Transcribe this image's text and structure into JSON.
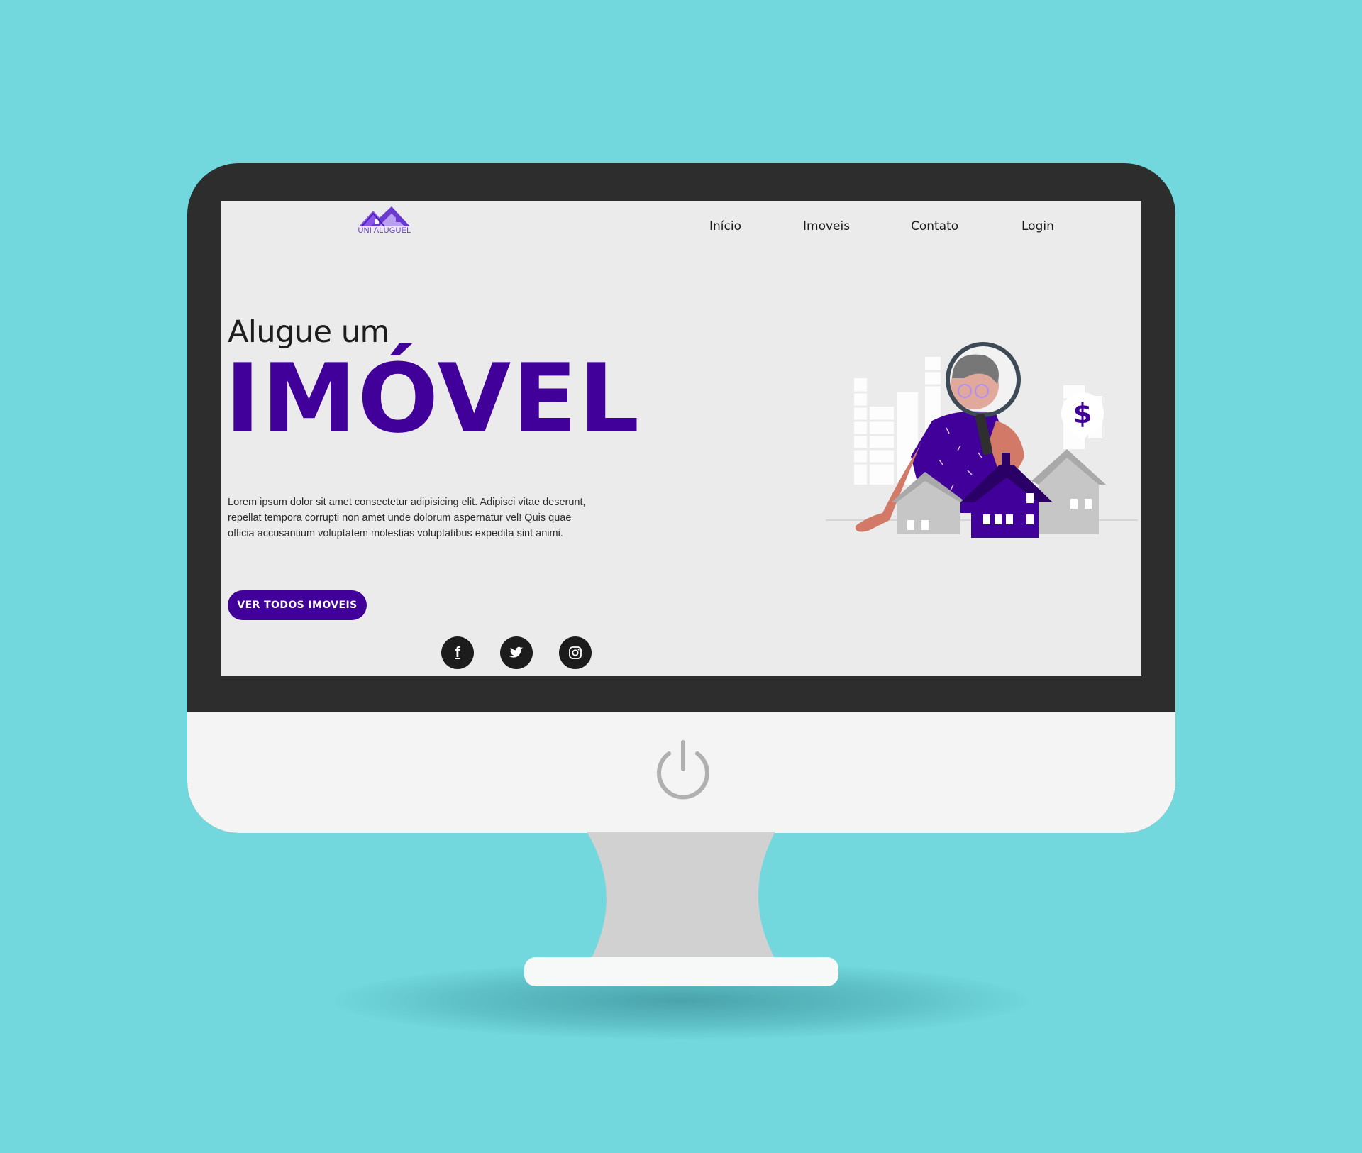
{
  "brand": {
    "logo_text": "UNI ALUGUEL"
  },
  "nav": {
    "items": [
      {
        "label": "Início"
      },
      {
        "label": "Imoveis"
      },
      {
        "label": "Contato"
      },
      {
        "label": "Login"
      }
    ]
  },
  "hero": {
    "subtitle": "Alugue um",
    "title": "IMÓVEL",
    "text": "Lorem ipsum dolor sit amet consectetur adipisicing elit. Adipisci vitae deserunt, repellat tempora corrupti non amet unde dolorum aspernatur vel! Quis quae officia accusantium voluptatem molestias voluptatibus expedita sint animi.",
    "cta_label": "VER TODOS IMOVEIS",
    "illustration_badge": "$"
  },
  "social": [
    {
      "icon": "facebook-icon",
      "glyph": "f"
    },
    {
      "icon": "twitter-icon"
    },
    {
      "icon": "instagram-icon"
    }
  ],
  "colors": {
    "background": "#72d8dd",
    "bezel": "#2d2d2d",
    "screen": "#ebebeb",
    "accent": "#410099",
    "chin": "#f4f4f4"
  }
}
